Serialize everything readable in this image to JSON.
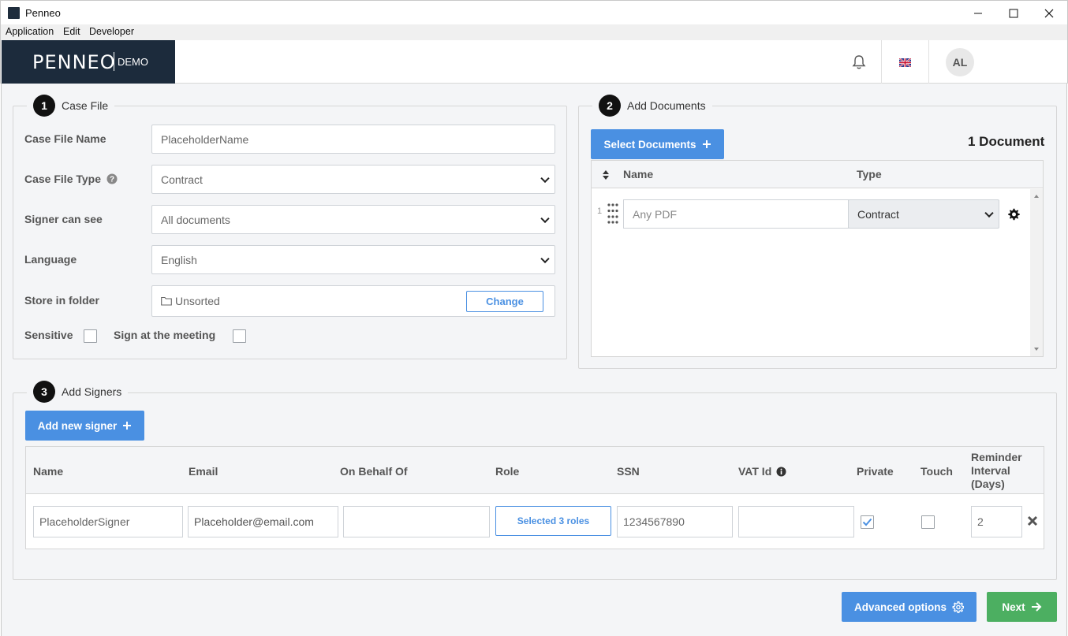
{
  "window": {
    "title": "Penneo",
    "minimize": "—",
    "maximize": "☐",
    "close": "✕"
  },
  "menu": [
    "Application",
    "Edit",
    "Developer"
  ],
  "header": {
    "brand": "PENNEO",
    "brand_tag": "DEMO",
    "avatar_initials": "AL",
    "icons": {
      "notifications": "bell-icon",
      "language": "uk-flag-icon"
    }
  },
  "case_file": {
    "step": "1",
    "legend": "Case File",
    "name_label": "Case File Name",
    "name_value": "PlaceholderName",
    "type_label": "Case File Type",
    "type_value": "Contract",
    "signer_see_label": "Signer can see",
    "signer_see_value": "All documents",
    "language_label": "Language",
    "language_value": "English",
    "folder_label": "Store in folder",
    "folder_value": "Unsorted",
    "change_button": "Change",
    "sensitive_label": "Sensitive",
    "sensitive_checked": false,
    "meeting_label": "Sign at the meeting",
    "meeting_checked": false
  },
  "documents": {
    "step": "2",
    "legend": "Add Documents",
    "select_button": "Select Documents",
    "count_text": "1 Document",
    "col_name": "Name",
    "col_type": "Type",
    "rows": [
      {
        "index": "1",
        "name_placeholder": "Any PDF",
        "type": "Contract"
      }
    ]
  },
  "signers": {
    "step": "3",
    "legend": "Add Signers",
    "add_button": "Add new signer",
    "columns": {
      "name": "Name",
      "email": "Email",
      "behalf": "On Behalf Of",
      "role": "Role",
      "ssn": "SSN",
      "vat": "VAT Id",
      "private": "Private",
      "touch": "Touch",
      "reminder_1": "Reminder",
      "reminder_2": "Interval",
      "reminder_3": "(Days)"
    },
    "rows": [
      {
        "name": "PlaceholderSigner",
        "email": "Placeholder@email.com",
        "behalf": "",
        "role": "Selected 3 roles",
        "ssn": "1234567890",
        "vat": "",
        "private": true,
        "touch": false,
        "reminder": "2"
      }
    ]
  },
  "footer": {
    "advanced_button": "Advanced options",
    "next_button": "Next"
  },
  "colors": {
    "accent": "#4a90e2",
    "success": "#4caf61",
    "logo_bg": "#1c2b3c"
  }
}
